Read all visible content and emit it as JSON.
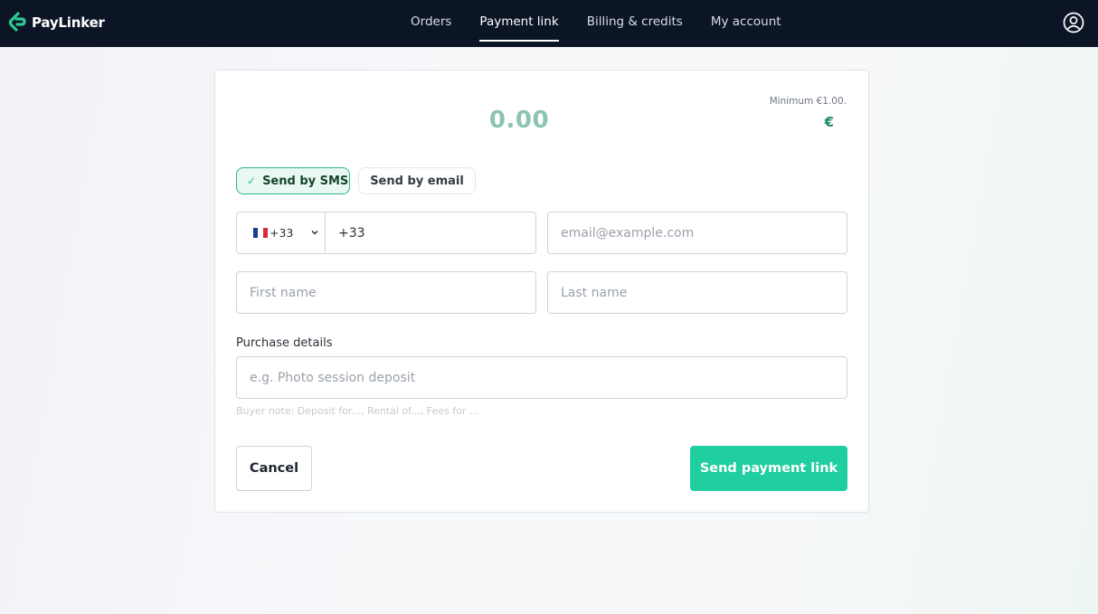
{
  "brand": {
    "name": "PayLinker",
    "color": "#2ec98f"
  },
  "nav": {
    "items": [
      {
        "label": "Orders",
        "active": false
      },
      {
        "label": "Payment link",
        "active": true
      },
      {
        "label": "Billing & credits",
        "active": false
      },
      {
        "label": "My account",
        "active": false
      }
    ]
  },
  "amount": {
    "placeholder": "0.00",
    "minimum_label": "Minimum €1.00.",
    "currency": "€"
  },
  "send_method": {
    "sms_label": "Send by SMS",
    "email_label": "Send by email",
    "selected": "sms"
  },
  "phone": {
    "country_code": "+33",
    "value": "+33"
  },
  "email": {
    "placeholder": "email@example.com"
  },
  "first_name": {
    "placeholder": "First name"
  },
  "last_name": {
    "placeholder": "Last name"
  },
  "purchase": {
    "label": "Purchase details",
    "placeholder": "e.g. Photo session deposit",
    "hint": "Buyer note: Deposit for..., Rental of..., Fees for ..."
  },
  "actions": {
    "cancel_label": "Cancel",
    "send_label": "Send payment link"
  },
  "colors": {
    "accent": "#1fcfa0",
    "topbar": "#0b1526",
    "amount": "#8cc4ad"
  }
}
